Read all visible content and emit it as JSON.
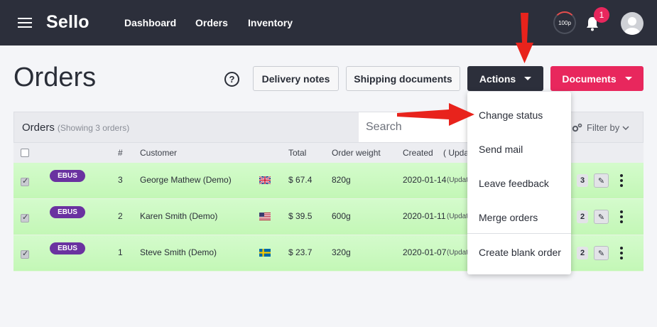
{
  "app": {
    "logo": "Sello",
    "nav": [
      "Dashboard",
      "Orders",
      "Inventory"
    ],
    "progress_label": "100p",
    "notification_count": "1"
  },
  "page": {
    "title": "Orders",
    "help_glyph": "?",
    "buttons": {
      "delivery_notes": "Delivery notes",
      "shipping_documents": "Shipping documents",
      "actions": "Actions",
      "documents": "Documents"
    }
  },
  "orders_panel": {
    "label": "Orders",
    "sublabel": "(Showing 3 orders)",
    "search_placeholder": "Search",
    "filter_label": "Filter by"
  },
  "columns": {
    "number": "#",
    "customer": "Customer",
    "total": "Total",
    "order_weight": "Order weight",
    "created": "Created",
    "updated_partial": "( Upda"
  },
  "rows": [
    {
      "tag": "EBUS",
      "number": "3",
      "customer": "George Mathew (Demo)",
      "flag": "uk",
      "total": "$ 67.4",
      "weight": "820g",
      "created": "2020-01-14",
      "updated": "(Updat",
      "count": "3",
      "checked": true
    },
    {
      "tag": "EBUS",
      "number": "2",
      "customer": "Karen Smith (Demo)",
      "flag": "us",
      "total": "$ 39.5",
      "weight": "600g",
      "created": "2020-01-11",
      "updated": "(Updat",
      "count": "2",
      "checked": true
    },
    {
      "tag": "EBUS",
      "number": "1",
      "customer": "Steve Smith (Demo)",
      "flag": "se",
      "total": "$ 23.7",
      "weight": "320g",
      "created": "2020-01-07",
      "updated": "(Updat",
      "count": "2",
      "checked": true
    }
  ],
  "actions_menu": [
    "Change status",
    "Send mail",
    "Leave feedback",
    "Merge orders",
    "Create blank order"
  ],
  "colors": {
    "topbar": "#2c2f3b",
    "accent_pink": "#e8275d",
    "ebus_purple": "#6a32a0",
    "row_green": "#c9f8bd",
    "annotation_red": "#e8231c"
  }
}
